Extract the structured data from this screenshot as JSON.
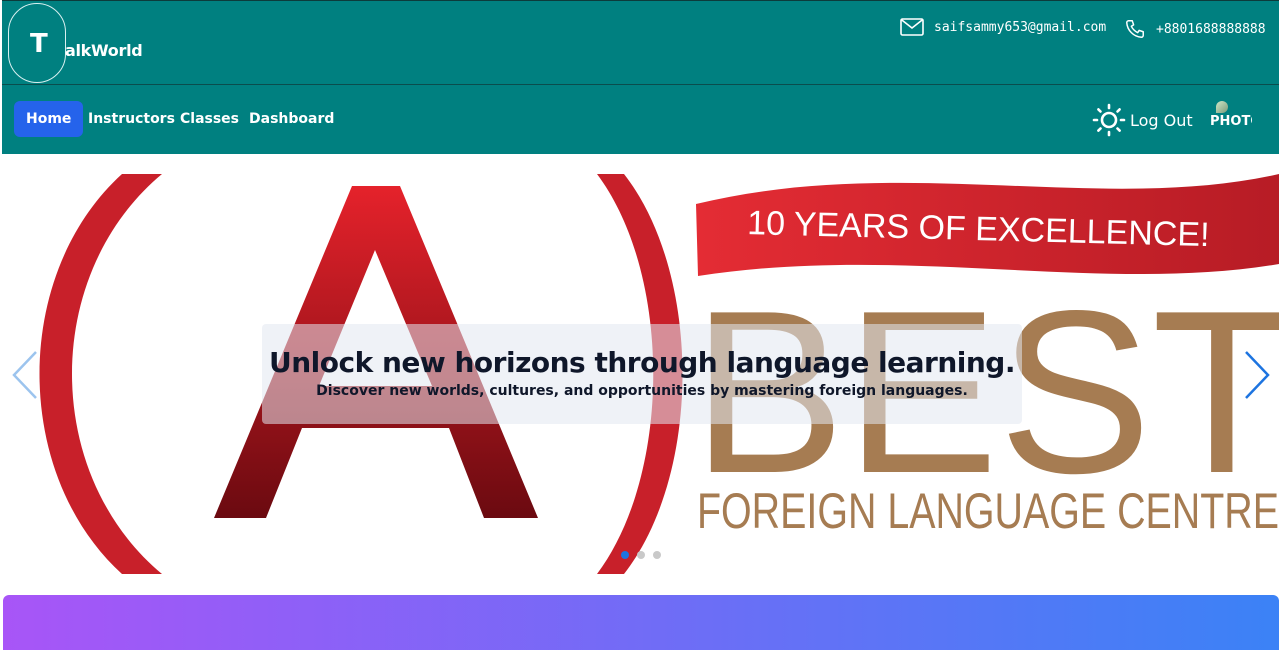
{
  "brand": {
    "letter": "T",
    "name": "alkWorld"
  },
  "contact": {
    "email": "saifsammy653@gmail.com",
    "phone": "+8801688888888"
  },
  "nav": {
    "items": [
      "Home",
      "Instructors",
      "Classes",
      "Dashboard"
    ],
    "active": "Home"
  },
  "user": {
    "logout_label": "Log Out",
    "photo_alt": "PHOTO"
  },
  "hero": {
    "title": "Unlock new horizons through language learning.",
    "subtitle": "Discover new worlds, cultures, and opportunities by mastering foreign languages.",
    "banner_text": "10 YEARS OF EXCELLENCE!",
    "logo_letter": "A",
    "logo_best": "BEST",
    "logo_centre": "FOREIGN LANGUAGE CENTRE",
    "slides_total": 3,
    "active_slide": 1
  },
  "colors": {
    "header": "#008080",
    "active_nav": "#2563eb",
    "accent_red": "#c8202a",
    "logo_brown": "#a67c52",
    "dot_active": "#1d74e0"
  }
}
